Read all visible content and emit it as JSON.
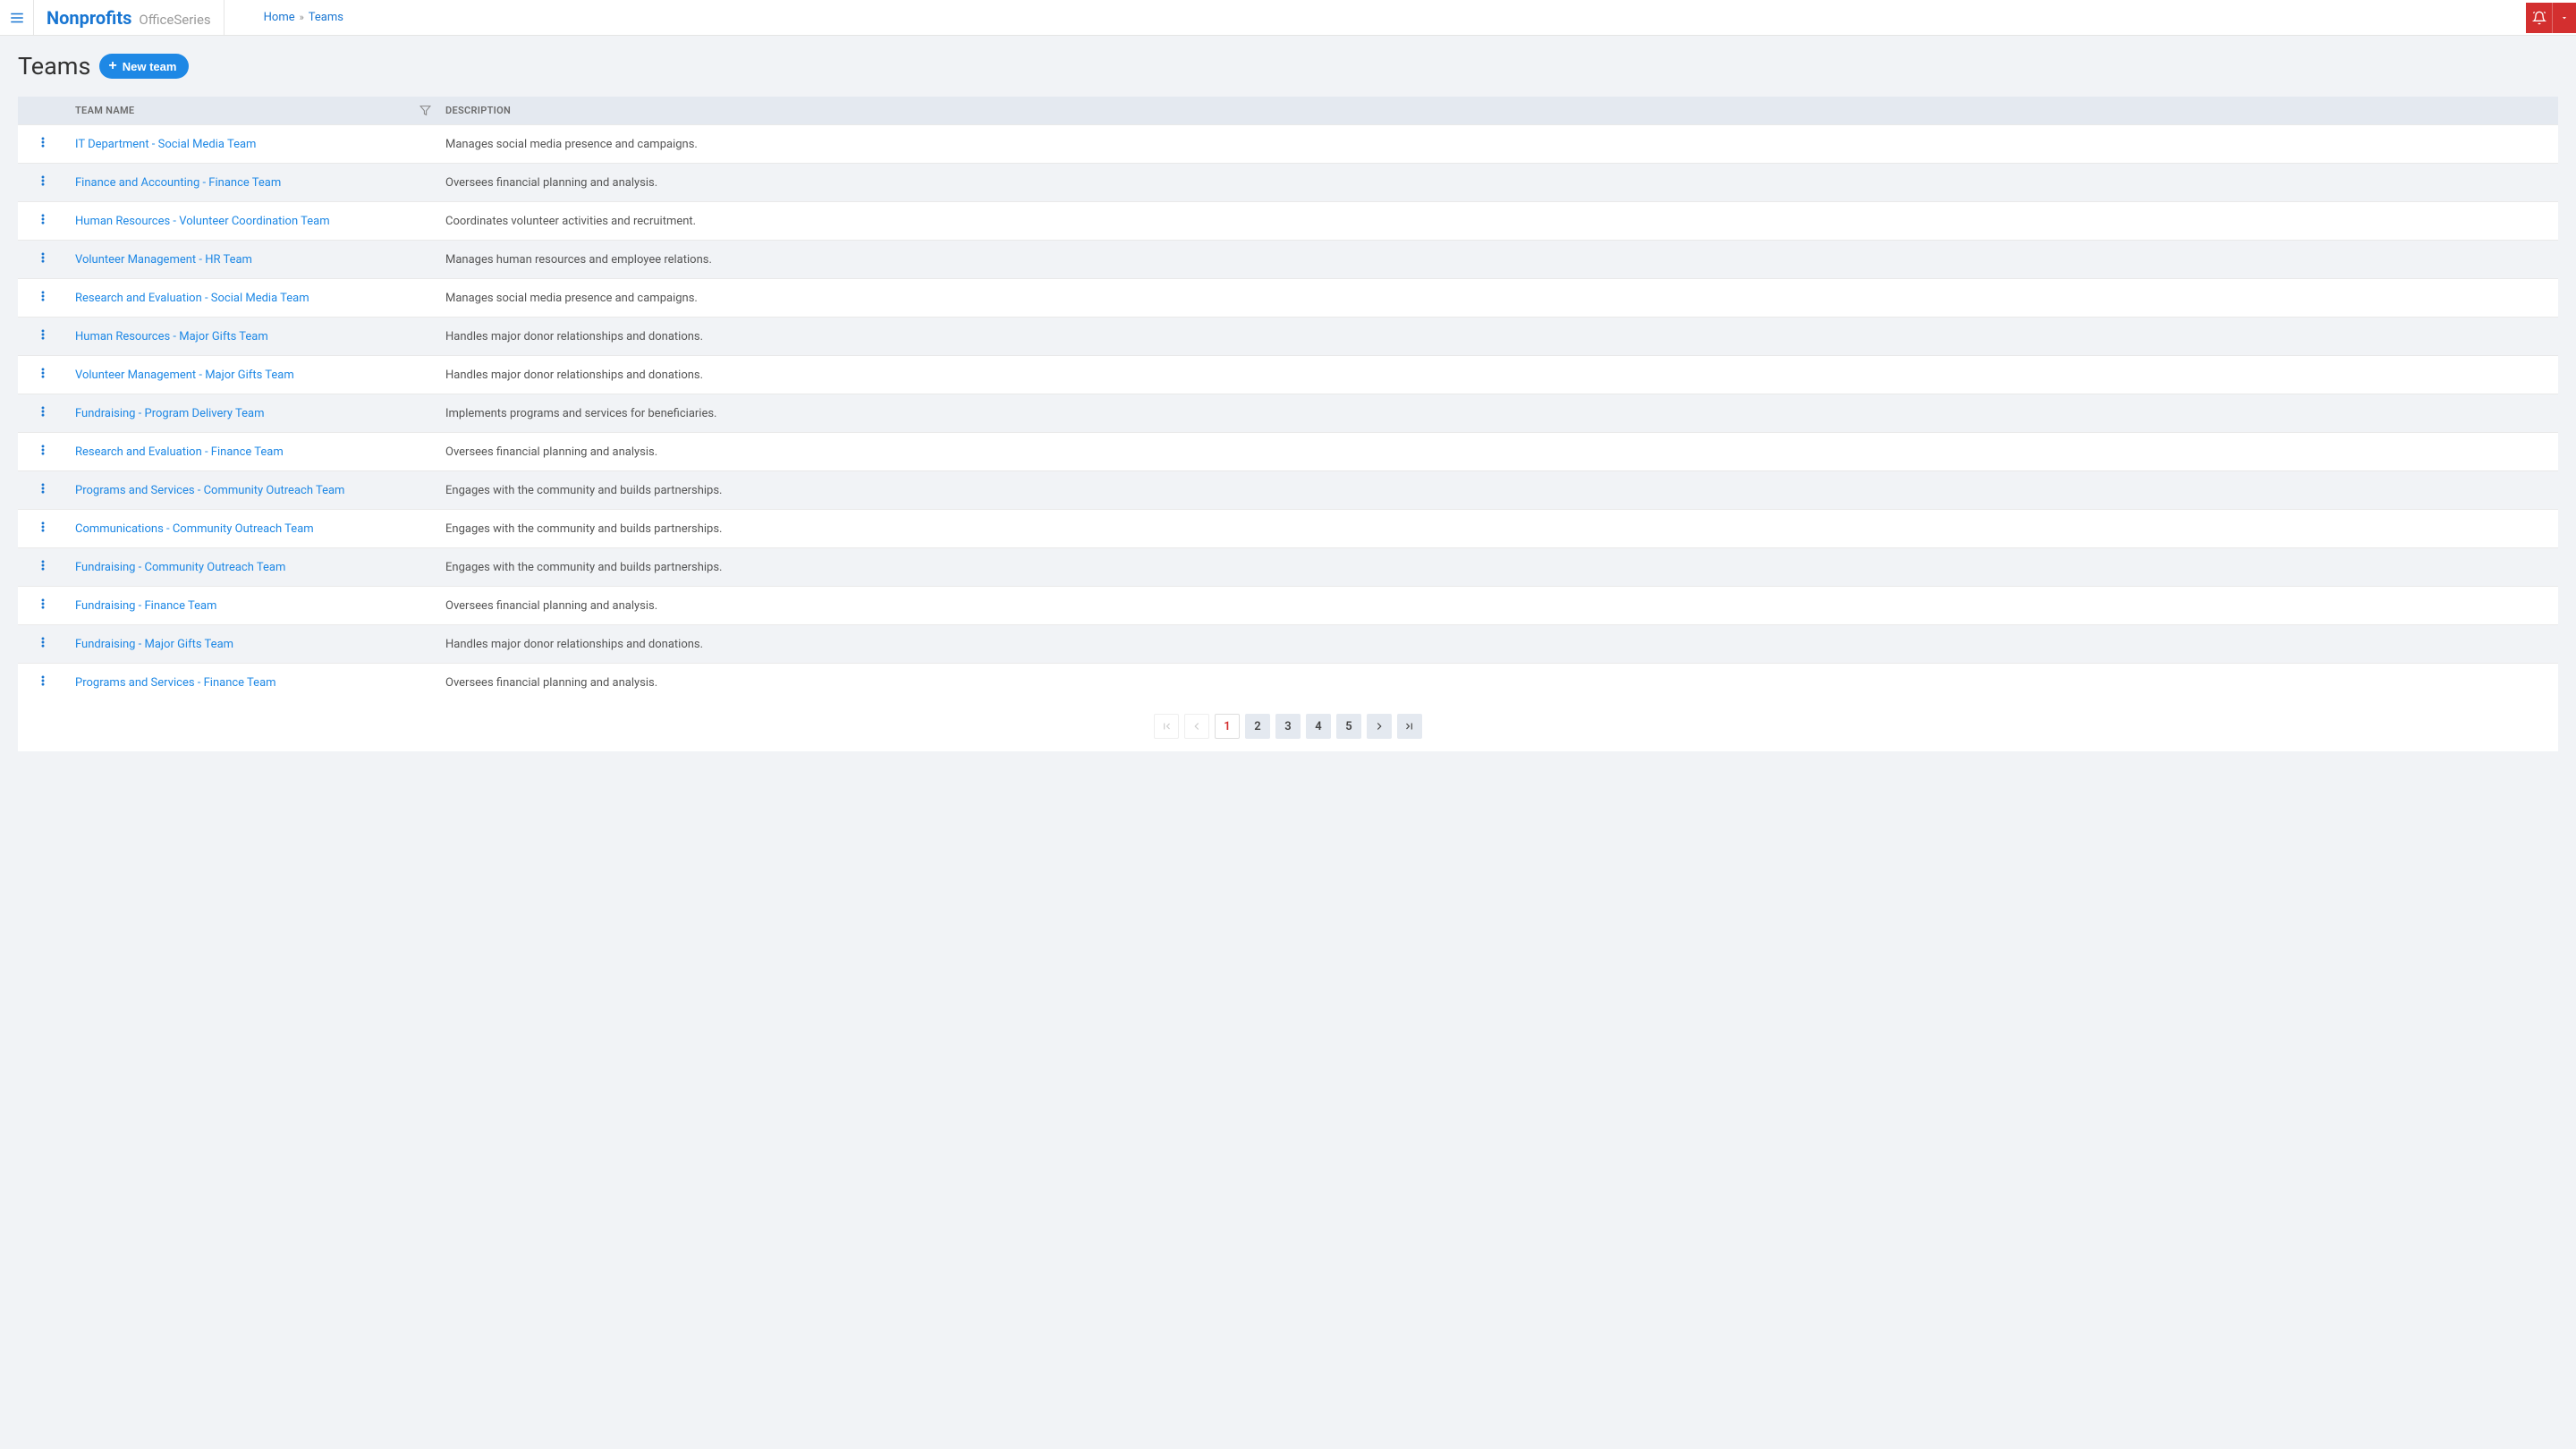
{
  "header": {
    "brand_primary": "Nonprofits",
    "brand_secondary": "OfficeSeries",
    "breadcrumb_home": "Home",
    "breadcrumb_current": "Teams"
  },
  "page": {
    "title": "Teams",
    "new_button_label": "New team"
  },
  "table": {
    "col_name": "TEAM NAME",
    "col_description": "DESCRIPTION",
    "rows": [
      {
        "name": "IT Department - Social Media Team",
        "description": "Manages social media presence and campaigns."
      },
      {
        "name": "Finance and Accounting - Finance Team",
        "description": "Oversees financial planning and analysis."
      },
      {
        "name": "Human Resources - Volunteer Coordination Team",
        "description": "Coordinates volunteer activities and recruitment."
      },
      {
        "name": "Volunteer Management - HR Team",
        "description": "Manages human resources and employee relations."
      },
      {
        "name": "Research and Evaluation - Social Media Team",
        "description": "Manages social media presence and campaigns."
      },
      {
        "name": "Human Resources - Major Gifts Team",
        "description": "Handles major donor relationships and donations."
      },
      {
        "name": "Volunteer Management - Major Gifts Team",
        "description": "Handles major donor relationships and donations."
      },
      {
        "name": "Fundraising - Program Delivery Team",
        "description": "Implements programs and services for beneficiaries."
      },
      {
        "name": "Research and Evaluation - Finance Team",
        "description": "Oversees financial planning and analysis."
      },
      {
        "name": "Programs and Services - Community Outreach Team",
        "description": "Engages with the community and builds partnerships."
      },
      {
        "name": "Communications - Community Outreach Team",
        "description": "Engages with the community and builds partnerships."
      },
      {
        "name": "Fundraising - Community Outreach Team",
        "description": "Engages with the community and builds partnerships."
      },
      {
        "name": "Fundraising - Finance Team",
        "description": "Oversees financial planning and analysis."
      },
      {
        "name": "Fundraising - Major Gifts Team",
        "description": "Handles major donor relationships and donations."
      },
      {
        "name": "Programs and Services - Finance Team",
        "description": "Oversees financial planning and analysis."
      }
    ]
  },
  "pagination": {
    "pages": [
      "1",
      "2",
      "3",
      "4",
      "5"
    ],
    "current": 1
  }
}
